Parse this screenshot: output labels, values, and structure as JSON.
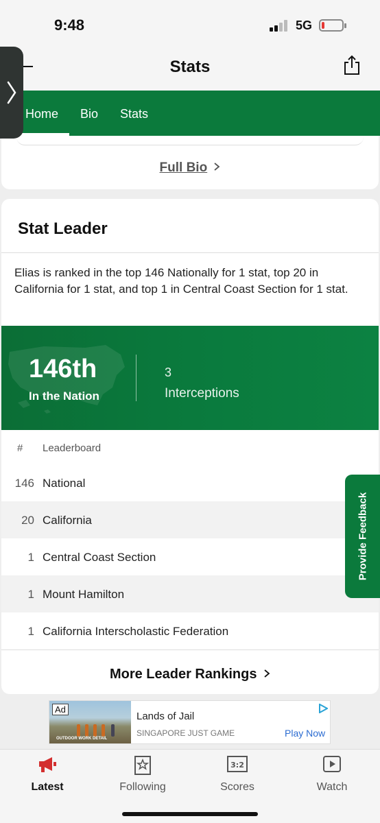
{
  "status_bar": {
    "time": "9:48",
    "network": "5G"
  },
  "header": {
    "title": "Stats"
  },
  "tabs": [
    {
      "label": "Home",
      "active": true
    },
    {
      "label": "Bio"
    },
    {
      "label": "Stats"
    }
  ],
  "bio_card": {
    "full_bio_label": "Full Bio"
  },
  "stat_leader": {
    "title": "Stat Leader",
    "description": "Elias is ranked in the top 146 Nationally for 1 stat, top 20 in California for 1 stat, and top 1 in Central Coast Section for 1 stat.",
    "banner": {
      "rank": "146th",
      "rank_label": "In the Nation",
      "stat_value": "3",
      "stat_name": "Interceptions"
    },
    "leaderboard": {
      "header_num": "#",
      "header_label": "Leaderboard",
      "rows": [
        {
          "num": "146",
          "name": "National"
        },
        {
          "num": "20",
          "name": "California"
        },
        {
          "num": "1",
          "name": "Central Coast Section"
        },
        {
          "num": "1",
          "name": "Mount Hamilton"
        },
        {
          "num": "1",
          "name": "California Interscholastic Federation"
        }
      ]
    },
    "more_label": "More Leader Rankings"
  },
  "feedback": {
    "label": "Provide Feedback"
  },
  "ad": {
    "badge": "Ad",
    "title": "Lands of Jail",
    "subtitle": "SINGAPORE JUST GAME",
    "cta": "Play Now",
    "image_caption": "OUTDOOR WORK DETAIL"
  },
  "bottom_nav": [
    {
      "label": "Latest",
      "icon": "megaphone-icon",
      "active": true
    },
    {
      "label": "Following",
      "icon": "star-bookmark-icon"
    },
    {
      "label": "Scores",
      "icon": "scoreboard-icon"
    },
    {
      "label": "Watch",
      "icon": "play-icon"
    }
  ],
  "colors": {
    "brand_green": "#0b7a3c",
    "active_red": "#d32f2f",
    "link_blue": "#2a6bd1"
  }
}
